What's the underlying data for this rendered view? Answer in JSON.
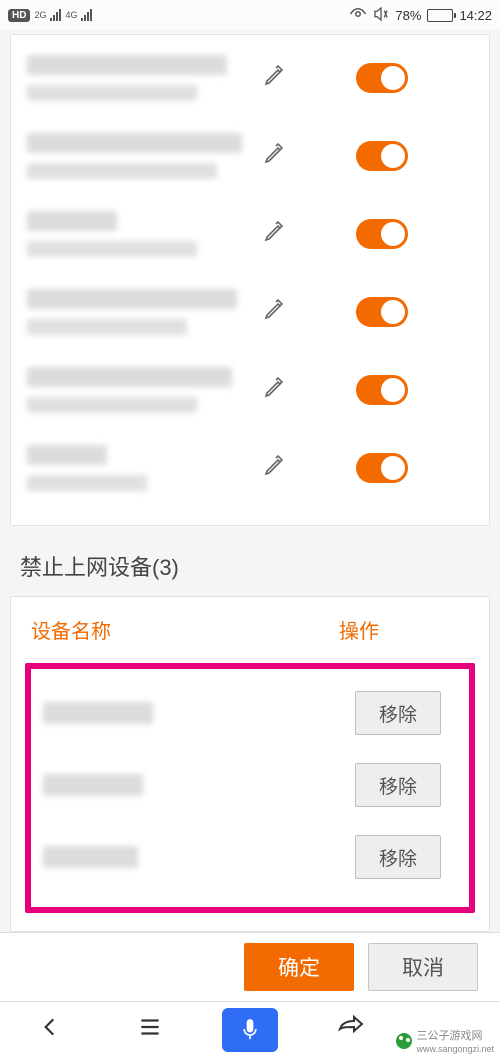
{
  "status": {
    "hd": "HD",
    "net1": "2G",
    "net2": "4G",
    "battery_pct": "78%",
    "time": "14:22"
  },
  "allowed": {
    "items": [
      {
        "toggle": true
      },
      {
        "toggle": true
      },
      {
        "toggle": true
      },
      {
        "toggle": true
      },
      {
        "toggle": true
      },
      {
        "toggle": true
      }
    ]
  },
  "blocked": {
    "title": "禁止上网设备(3)",
    "col_device": "设备名称",
    "col_action": "操作",
    "remove_label": "移除",
    "items": [
      {},
      {},
      {}
    ]
  },
  "actions": {
    "ok": "确定",
    "cancel": "取消"
  },
  "watermark": {
    "brand": "三公子游戏网",
    "url": "www.sangongzi.net"
  }
}
